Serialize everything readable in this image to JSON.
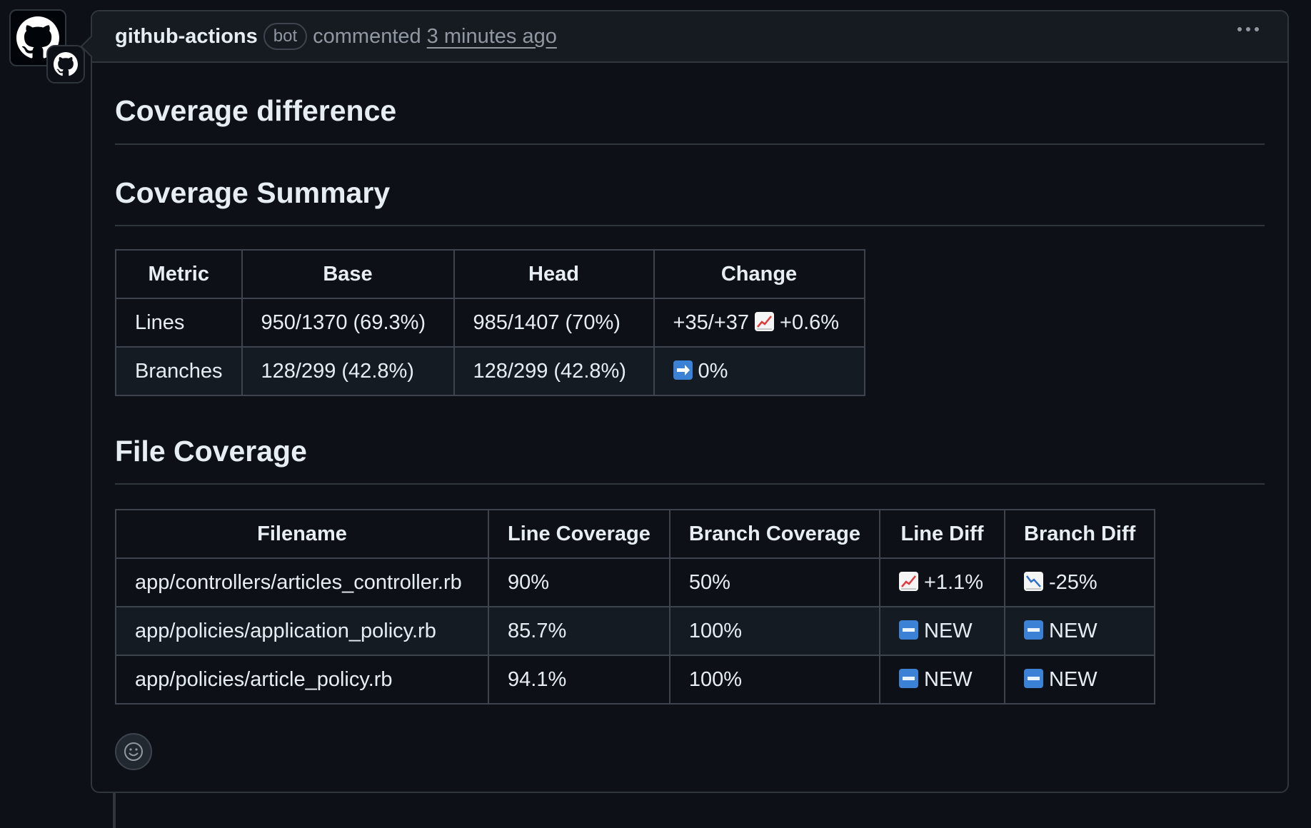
{
  "author": {
    "name": "github-actions",
    "badge": "bot",
    "action": "commented",
    "time": "3 minutes ago"
  },
  "headings": {
    "diff": "Coverage difference",
    "summary": "Coverage Summary",
    "file": "File Coverage"
  },
  "summary_table": {
    "headers": [
      "Metric",
      "Base",
      "Head",
      "Change"
    ],
    "rows": [
      {
        "metric": "Lines",
        "base": "950/1370 (69.3%)",
        "head": "985/1407 (70%)",
        "change_prefix": "+35/+37",
        "change_icon": "chart-increasing",
        "change_value": "+0.6%"
      },
      {
        "metric": "Branches",
        "base": "128/299 (42.8%)",
        "head": "128/299 (42.8%)",
        "change_prefix": "",
        "change_icon": "right-arrow",
        "change_value": "0%"
      }
    ]
  },
  "file_table": {
    "headers": [
      "Filename",
      "Line Coverage",
      "Branch Coverage",
      "Line Diff",
      "Branch Diff"
    ],
    "rows": [
      {
        "filename": "app/controllers/articles_controller.rb",
        "line_cov": "90%",
        "branch_cov": "50%",
        "line_diff_icon": "chart-increasing",
        "line_diff": "+1.1%",
        "branch_diff_icon": "chart-decreasing",
        "branch_diff": "-25%"
      },
      {
        "filename": "app/policies/application_policy.rb",
        "line_cov": "85.7%",
        "branch_cov": "100%",
        "line_diff_icon": "new-button",
        "line_diff": "NEW",
        "branch_diff_icon": "new-button",
        "branch_diff": "NEW"
      },
      {
        "filename": "app/policies/article_policy.rb",
        "line_cov": "94.1%",
        "branch_cov": "100%",
        "line_diff_icon": "new-button",
        "line_diff": "NEW",
        "branch_diff_icon": "new-button",
        "branch_diff": "NEW"
      }
    ]
  },
  "colors": {
    "background": "#0d1117",
    "header_bg": "#161b22",
    "border": "#30363d",
    "text": "#e6edf3",
    "muted": "#9198a1"
  }
}
